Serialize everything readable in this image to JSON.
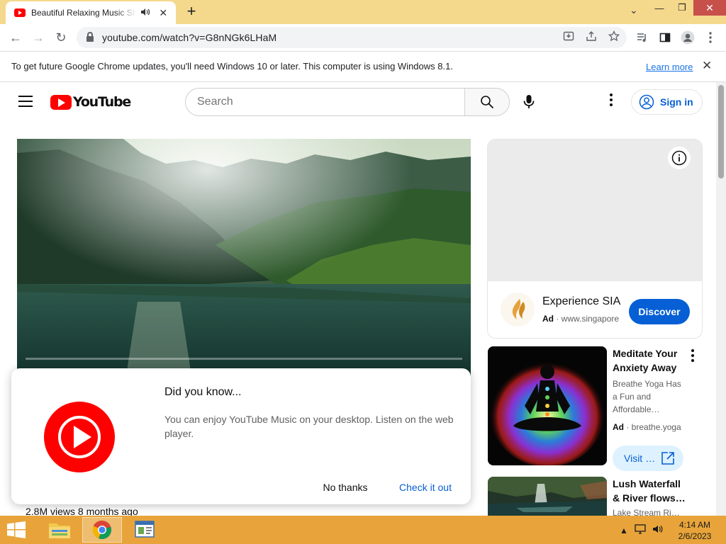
{
  "browser": {
    "tab_title": "Beautiful Relaxing Music Stre",
    "tab_favicon": "youtube-favicon",
    "new_tab_label": "+",
    "url": "youtube.com/watch?v=G8nNGk6LHaM",
    "window_controls": {
      "minimize": "—",
      "restore": "❐",
      "close": "✕",
      "tab_search": "⌄"
    },
    "nav": {
      "back": "←",
      "forward": "→",
      "reload": "↻"
    }
  },
  "infobar": {
    "message": "To get future Google Chrome updates, you'll need Windows 10 or later. This computer is using Windows 8.1.",
    "link": "Learn more",
    "close": "✕"
  },
  "youtube": {
    "logo_text": "YouTube",
    "search_placeholder": "Search",
    "sign_in": "Sign in",
    "video_meta": "2.8M views  8 months ago",
    "popup": {
      "title": "Did you know...",
      "body": "You can enjoy YouTube Music on your desktop. Listen on the web player.",
      "no_thanks": "No thanks",
      "check_it_out": "Check it out"
    },
    "ad": {
      "title": "Experience SIA",
      "ad_label": "Ad",
      "domain": "www.singapore",
      "cta": "Discover"
    },
    "sponsored": {
      "title": "Meditate Your Anxiety Away",
      "description": "Breathe Yoga Has a Fun and Affordable…",
      "ad_label": "Ad",
      "domain": "breathe.yoga",
      "cta": "Visit …"
    },
    "next_video": {
      "title_line1": "Lush Waterfall",
      "title_line2": "& River flows I…",
      "channel": "Lake Stream Riv…"
    }
  },
  "taskbar": {
    "time": "4:14 AM",
    "date": "2/6/2023"
  },
  "colors": {
    "tabstrip": "#f4d88c",
    "youtube_red": "#ff0000",
    "link_blue": "#065fd4",
    "taskbar": "#e8a43a"
  }
}
